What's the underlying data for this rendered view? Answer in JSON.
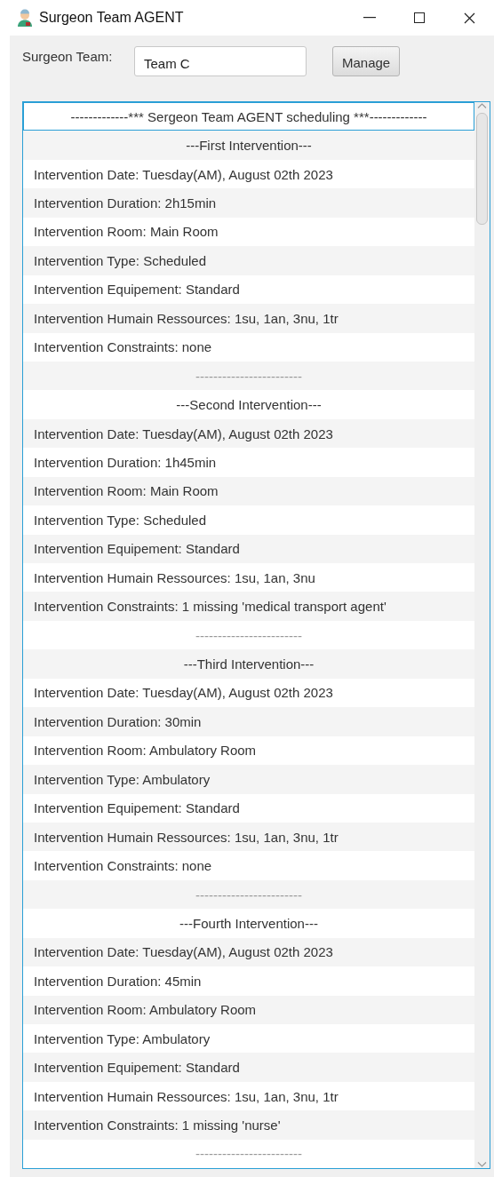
{
  "window": {
    "title": "Surgeon Team AGENT"
  },
  "team": {
    "label": "Surgeon Team:",
    "value": "Team C",
    "button": "Manage"
  },
  "list": [
    {
      "kind": "header",
      "text": "-------------*** Sergeon Team AGENT scheduling  ***-------------",
      "selected": true
    },
    {
      "kind": "title",
      "text": "---First Intervention---",
      "selected": false
    },
    {
      "kind": "line",
      "text": "Intervention Date: Tuesday(AM), August 02th 2023",
      "selected": false
    },
    {
      "kind": "line",
      "text": "Intervention Duration: 2h15min",
      "selected": false
    },
    {
      "kind": "line",
      "text": "Intervention Room: Main Room",
      "selected": false
    },
    {
      "kind": "line",
      "text": "Intervention Type: Scheduled",
      "selected": false
    },
    {
      "kind": "line",
      "text": "Intervention Equipement: Standard",
      "selected": false
    },
    {
      "kind": "line",
      "text": "Intervention Humain Ressources: 1su, 1an, 3nu, 1tr",
      "selected": false
    },
    {
      "kind": "line",
      "text": "Intervention Constraints: none",
      "selected": false
    },
    {
      "kind": "separator",
      "text": "------------------------",
      "selected": false
    },
    {
      "kind": "title",
      "text": "---Second Intervention---",
      "selected": false
    },
    {
      "kind": "line",
      "text": "Intervention Date: Tuesday(AM), August 02th 2023",
      "selected": false
    },
    {
      "kind": "line",
      "text": "Intervention Duration: 1h45min",
      "selected": false
    },
    {
      "kind": "line",
      "text": "Intervention Room: Main Room",
      "selected": false
    },
    {
      "kind": "line",
      "text": "Intervention Type: Scheduled",
      "selected": false
    },
    {
      "kind": "line",
      "text": "Intervention Equipement: Standard",
      "selected": false
    },
    {
      "kind": "line",
      "text": "Intervention Humain Ressources: 1su, 1an, 3nu",
      "selected": false
    },
    {
      "kind": "line",
      "text": "Intervention Constraints: 1 missing 'medical transport agent'",
      "selected": false
    },
    {
      "kind": "separator",
      "text": "------------------------",
      "selected": false
    },
    {
      "kind": "title",
      "text": "---Third Intervention---",
      "selected": false
    },
    {
      "kind": "line",
      "text": "Intervention Date: Tuesday(AM), August 02th 2023",
      "selected": false
    },
    {
      "kind": "line",
      "text": "Intervention Duration: 30min",
      "selected": false
    },
    {
      "kind": "line",
      "text": "Intervention Room: Ambulatory Room",
      "selected": false
    },
    {
      "kind": "line",
      "text": "Intervention Type: Ambulatory",
      "selected": false
    },
    {
      "kind": "line",
      "text": "Intervention Equipement: Standard",
      "selected": false
    },
    {
      "kind": "line",
      "text": "Intervention Humain Ressources: 1su, 1an, 3nu, 1tr",
      "selected": false
    },
    {
      "kind": "line",
      "text": "Intervention Constraints: none",
      "selected": false
    },
    {
      "kind": "separator",
      "text": "------------------------",
      "selected": false
    },
    {
      "kind": "title",
      "text": "---Fourth Intervention---",
      "selected": false
    },
    {
      "kind": "line",
      "text": "Intervention Date: Tuesday(AM), August 02th 2023",
      "selected": false
    },
    {
      "kind": "line",
      "text": "Intervention Duration: 45min",
      "selected": false
    },
    {
      "kind": "line",
      "text": "Intervention Room: Ambulatory Room",
      "selected": false
    },
    {
      "kind": "line",
      "text": "Intervention Type: Ambulatory",
      "selected": false
    },
    {
      "kind": "line",
      "text": "Intervention Equipement: Standard",
      "selected": false
    },
    {
      "kind": "line",
      "text": "Intervention Humain Ressources: 1su, 1an, 3nu, 1tr",
      "selected": false
    },
    {
      "kind": "line",
      "text": "Intervention Constraints: 1 missing 'nurse'",
      "selected": false
    },
    {
      "kind": "separator",
      "text": "------------------------",
      "selected": false
    }
  ]
}
